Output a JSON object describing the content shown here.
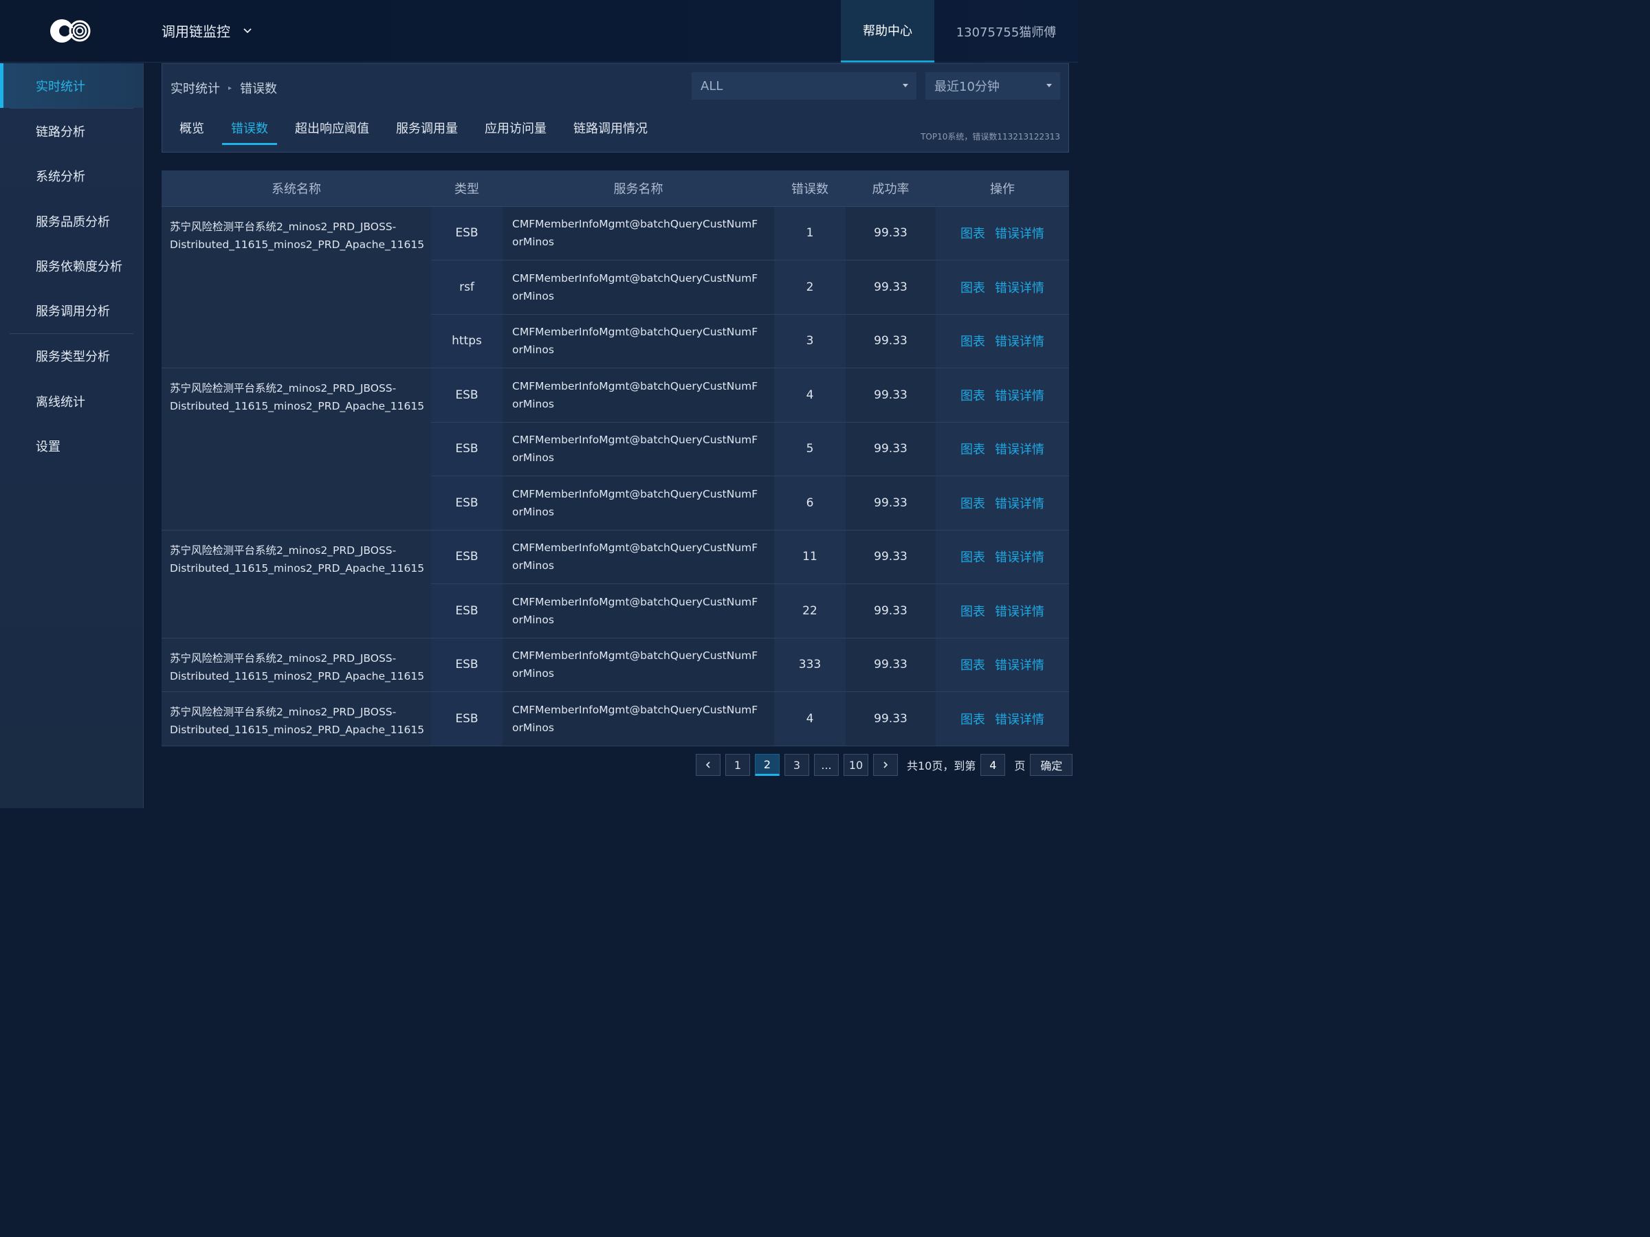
{
  "header": {
    "app_title": "调用链监控",
    "help_label": "帮助中心",
    "user_label": "13075755猫师傅"
  },
  "sidebar": {
    "items": [
      {
        "label": "实时统计",
        "active": true
      },
      {
        "label": "链路分析"
      },
      {
        "label": "系统分析"
      },
      {
        "label": "服务品质分析"
      },
      {
        "label": "服务依赖度分析"
      },
      {
        "label": "服务调用分析"
      },
      {
        "label": "服务类型分析"
      },
      {
        "label": "离线统计"
      },
      {
        "label": "设置"
      }
    ]
  },
  "breadcrumb": {
    "parent": "实时统计",
    "current": "错误数"
  },
  "filters": {
    "system_select": "ALL",
    "time_select": "最近10分钟"
  },
  "tabs": [
    "概览",
    "错误数",
    "超出响应阈值",
    "服务调用量",
    "应用访问量",
    "链路调用情况"
  ],
  "active_tab": "错误数",
  "summary": "TOP10系统，错误数113213122313",
  "table": {
    "headers": [
      "系统名称",
      "类型",
      "服务名称",
      "错误数",
      "成功率",
      "操作"
    ],
    "system_name_line1": "苏宁风险检测平台系统2_minos2_PRD_JBOSS-",
    "system_name_line2": "Distributed_11615_minos2_PRD_Apache_11615",
    "service_line1": "CMFMemberInfoMgmt@batchQueryCustNumF",
    "service_line2": "orMinos",
    "action_chart": "图表",
    "action_detail": "错误详情",
    "rows": [
      {
        "type": "ESB",
        "errors": "1",
        "rate": "99.33"
      },
      {
        "type": "rsf",
        "errors": "2",
        "rate": "99.33"
      },
      {
        "type": "https",
        "errors": "3",
        "rate": "99.33"
      },
      {
        "type": "ESB",
        "errors": "4",
        "rate": "99.33"
      },
      {
        "type": "ESB",
        "errors": "5",
        "rate": "99.33"
      },
      {
        "type": "ESB",
        "errors": "6",
        "rate": "99.33"
      },
      {
        "type": "ESB",
        "errors": "11",
        "rate": "99.33"
      },
      {
        "type": "ESB",
        "errors": "22",
        "rate": "99.33"
      },
      {
        "type": "ESB",
        "errors": "333",
        "rate": "99.33"
      },
      {
        "type": "ESB",
        "errors": "4",
        "rate": "99.33"
      }
    ]
  },
  "pagination": {
    "pages": [
      "1",
      "2",
      "3",
      "...",
      "10"
    ],
    "current": "2",
    "total_text": "共10页，到第",
    "goto_value": "4",
    "page_suffix": "页",
    "confirm_label": "确定"
  },
  "colors": {
    "accent": "#1fb2e8",
    "background": "#0e1c33",
    "sidebar": "#1b2d4a",
    "link": "#1ea9e2"
  },
  "icons": [
    "logo-icon",
    "chevron-down-icon",
    "caret-down-icon",
    "prev-page-icon",
    "next-page-icon"
  ]
}
